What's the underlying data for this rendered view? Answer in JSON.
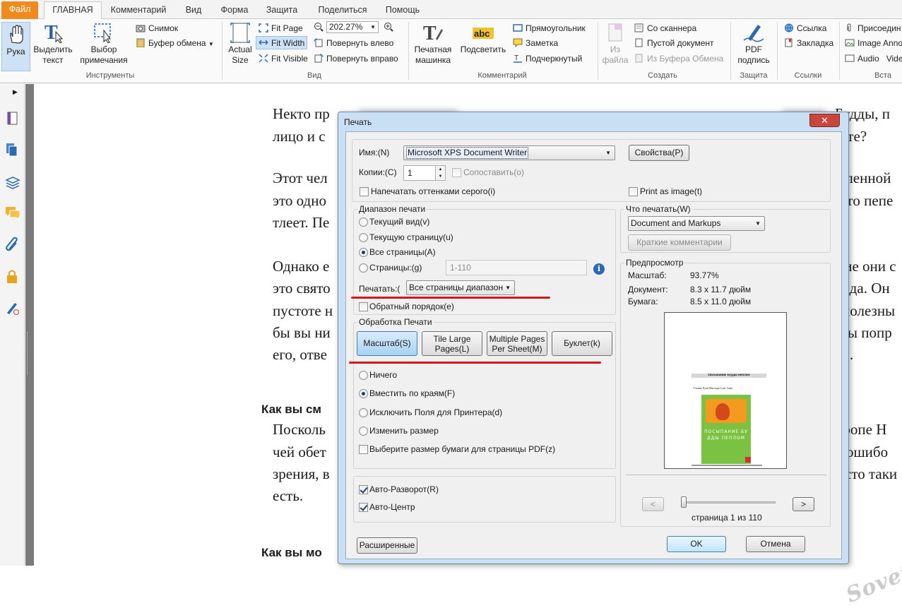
{
  "ribbon": {
    "tabs": [
      "Файл",
      "ГЛАВНАЯ",
      "Комментарий",
      "Вид",
      "Форма",
      "Защита",
      "Поделиться",
      "Помощь"
    ],
    "tools": {
      "hand": "Рука",
      "select_text": "Выделить текст",
      "select_annot": "Выбор примечания",
      "snapshot": "Снимок",
      "clipboard": "Буфер обмена",
      "group_label": "Инструменты"
    },
    "view": {
      "actual_size": "Actual Size",
      "fit_page": "Fit Page",
      "fit_width": "Fit Width",
      "fit_visible": "Fit Visible",
      "zoom": "202.27%",
      "rotate_left": "Повернуть влево",
      "rotate_right": "Повернуть вправо",
      "group_label": "Вид"
    },
    "comment": {
      "typewriter": "Печатная машинка",
      "highlight": "Подсветить",
      "rectangle": "Прямоугольник",
      "note": "Заметка",
      "underline": "Подчеркнутый",
      "group_label": "Комментарий"
    },
    "create": {
      "from_file": "Из файла",
      "from_scanner": "Со сканнера",
      "blank_doc": "Пустой документ",
      "from_clipboard": "Из Буфера Обмена",
      "group_label": "Создать"
    },
    "protect": {
      "pdf_sign": "PDF подпись",
      "group_label": "Защита"
    },
    "links": {
      "link": "Ссылка",
      "bookmark": "Закладка",
      "group_label": "Ссылки"
    },
    "insert": {
      "attach": "Присоедин",
      "image": "Image Anno",
      "audio": "Audio",
      "video": "Vide",
      "group_label": "Вста"
    }
  },
  "document": {
    "lines": [
      {
        "left": "Некто пр",
        "right": "Будды, п"
      },
      {
        "left": "лицо и с",
        "right": "ете?"
      },
      {
        "left": "Этот чел",
        "right": "еленной"
      },
      {
        "left": "это одно",
        "right": "уто пепе"
      },
      {
        "left": "тлеет. Пе",
        "right": ""
      },
      {
        "left": "Однако е",
        "right": "ние они с"
      },
      {
        "left": "это свято",
        "right": "дда. Он"
      },
      {
        "left": "пустоте н",
        "right": "полезны"
      },
      {
        "left": "бы вы ни",
        "right": "вы попр"
      },
      {
        "left": "его, отве",
        "right": ")."
      },
      {
        "left": "Посколь",
        "right": "тропе Н"
      },
      {
        "left": "чей обет",
        "right": "ошибо"
      },
      {
        "left": "зрения, в",
        "right": "сто таки"
      },
      {
        "left": "есть.",
        "right": ""
      }
    ],
    "heading1": "Как вы см",
    "heading2": "Как вы мо",
    "watermark": "Sovet"
  },
  "dialog": {
    "title": "Печать",
    "close": "✕",
    "printer_label": "Имя:(N)",
    "printer_value": "Microsoft XPS Document Writer",
    "properties": "Свойства(P)",
    "copies_label": "Копии:(C)",
    "copies_value": "1",
    "collate": "Сопоставить(o)",
    "grayscale": "Напечатать оттенками серого(i)",
    "print_as_image": "Print as image(t)",
    "range_title": "Диапазон печати",
    "range_current_view": "Текущий вид(v)",
    "range_current_page": "Текущую страницу(u)",
    "range_all_pages": "Все страницы(A)",
    "range_pages": "Страницы:(g)",
    "range_pages_value": "1-110",
    "print_label": "Печатать:(",
    "print_value": "Все страницы диапазон",
    "reverse": "Обратный порядок(e)",
    "handling_title": "Обработка Печати",
    "tab_scale": "Масштаб(S)",
    "tab_tile": "Tile Large\nPages(L)",
    "tab_multiple": "Multiple Pages\nPer Sheet(M)",
    "tab_booklet": "Буклет(k)",
    "opt_none": "Ничего",
    "opt_fit": "Вместить по краям(F)",
    "opt_exclude": "Исключить Поля для Принтера(d)",
    "opt_resize": "Изменить размер",
    "opt_paper_size": "Выберите размер бумаги для страницы PDF(z)",
    "auto_rotate": "Авто-Разворот(R)",
    "auto_center": "Авто-Центр",
    "what_print_title": "Что печатать(W)",
    "what_print_value": "Document and Markups",
    "summarize": "Краткие комментарии",
    "preview_title": "Предпросмотр",
    "scale_label": "Масштаб:",
    "scale_value": "93.77%",
    "doc_label": "Документ:",
    "doc_value": "8.3 x 11.7 дюйм",
    "paper_label": "Бумага:",
    "paper_value": "8.5 x 11.0 дюйм",
    "page_counter": "страница 1 из 110",
    "prev": "<",
    "next": ">",
    "advanced": "Расширенные",
    "ok": "OK",
    "cancel": "Отмена",
    "preview_page_title": "Посыпание Будды пеплом",
    "preview_page_sub": "Учение Дзэн Мастера Сунг Сана",
    "preview_cover_text": "ПОСЫПАНИЕ БУДДЫ ПЕПЛОМ"
  },
  "colors": {
    "file_tab": "#f08a1c",
    "red_underline": "#d4161b",
    "dialog_frame": "#c9dff3",
    "close_button": "#c9463c",
    "cover_green": "#7cc242",
    "cover_orange": "#f39a1f"
  }
}
